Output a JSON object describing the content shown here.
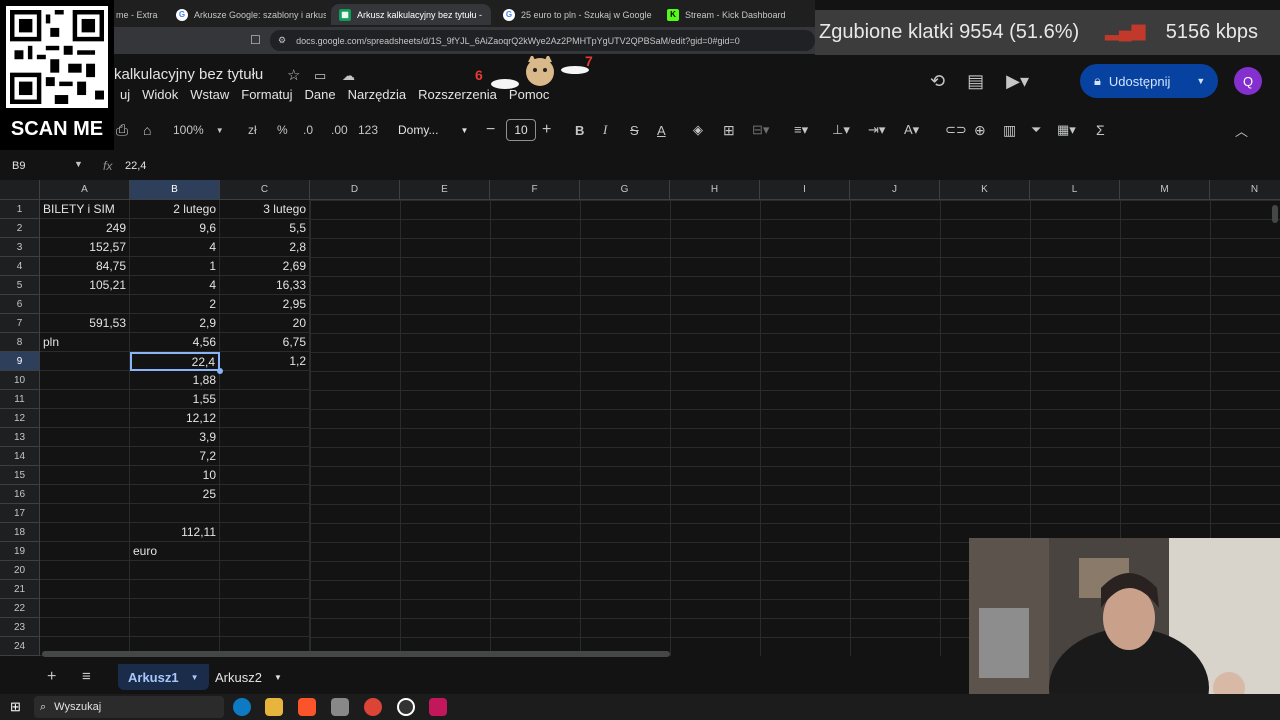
{
  "browser": {
    "tabs": [
      {
        "label": "me - Extra",
        "active": false
      },
      {
        "label": "Arkusze Google: szablony i arkusze k",
        "active": false
      },
      {
        "label": "Arkusz kalkulacyjny bez tytułu -",
        "active": true
      },
      {
        "label": "25 euro to pln - Szukaj w Google",
        "active": false
      },
      {
        "label": "Stream - Kick Dashboard",
        "active": false
      }
    ],
    "url": "docs.google.com/spreadsheets/d/1S_9fYJL_6AiZaoqrQ2kWye2Az2PMHTpYgUTV2QPBSaM/edit?gid=0#gid=0"
  },
  "overlay": {
    "dropped_frames": "Zgubione klatki 9554 (51.6%)",
    "bitrate": "5156 kbps",
    "qr_label": "SCAN ME"
  },
  "doc": {
    "title": "kalkulacyjny bez tytułu",
    "menu": [
      "uj",
      "Widok",
      "Wstaw",
      "Formatuj",
      "Dane",
      "Narzędzia",
      "Rozszerzenia",
      "Pomoc"
    ],
    "share_label": "Udostępnij",
    "avatar_letter": "Q"
  },
  "toolbar": {
    "zoom": "100%",
    "currency": "zł",
    "percent": "%",
    "dec_less": ".0",
    "dec_more": ".00",
    "format_123": "123",
    "font": "Domy...",
    "font_size": "10"
  },
  "formula": {
    "cell_ref": "B9",
    "fx": "fx",
    "value": "22,4"
  },
  "grid": {
    "columns": [
      "A",
      "B",
      "C",
      "D",
      "E",
      "F",
      "G",
      "H",
      "I",
      "J",
      "K",
      "L",
      "M",
      "N"
    ],
    "selected_column": "B",
    "selected_row": 9,
    "rows": [
      {
        "n": "1",
        "A": "BILETY i SIM",
        "B": "2 lutego",
        "C": "3 lutego"
      },
      {
        "n": "2",
        "A": "249",
        "B": "9,6",
        "C": "5,5"
      },
      {
        "n": "3",
        "A": "152,57",
        "B": "4",
        "C": "2,8"
      },
      {
        "n": "4",
        "A": "84,75",
        "B": "1",
        "C": "2,69"
      },
      {
        "n": "5",
        "A": "105,21",
        "B": "4",
        "C": "16,33"
      },
      {
        "n": "6",
        "A": "",
        "B": "2",
        "C": "2,95"
      },
      {
        "n": "7",
        "A": "591,53",
        "B": "2,9",
        "C": "20"
      },
      {
        "n": "8",
        "A": "pln",
        "B": "4,56",
        "C": "6,75"
      },
      {
        "n": "9",
        "A": "",
        "B": "22,4",
        "C": "1,2"
      },
      {
        "n": "10",
        "A": "",
        "B": "1,88",
        "C": ""
      },
      {
        "n": "11",
        "A": "",
        "B": "1,55",
        "C": ""
      },
      {
        "n": "12",
        "A": "",
        "B": "12,12",
        "C": ""
      },
      {
        "n": "13",
        "A": "",
        "B": "3,9",
        "C": ""
      },
      {
        "n": "14",
        "A": "",
        "B": "7,2",
        "C": ""
      },
      {
        "n": "15",
        "A": "",
        "B": "10",
        "C": ""
      },
      {
        "n": "16",
        "A": "",
        "B": "25",
        "C": ""
      },
      {
        "n": "17",
        "A": "",
        "B": "",
        "C": ""
      },
      {
        "n": "18",
        "A": "",
        "B": "112,11",
        "C": ""
      },
      {
        "n": "19",
        "A": "",
        "B": "euro",
        "C": ""
      },
      {
        "n": "20",
        "A": "",
        "B": "",
        "C": ""
      },
      {
        "n": "21",
        "A": "",
        "B": "",
        "C": ""
      },
      {
        "n": "22",
        "A": "",
        "B": "",
        "C": ""
      },
      {
        "n": "23",
        "A": "",
        "B": "",
        "C": ""
      },
      {
        "n": "24",
        "A": "",
        "B": "",
        "C": ""
      }
    ]
  },
  "sheets": [
    {
      "label": "Arkusz1",
      "active": true
    },
    {
      "label": "Arkusz2",
      "active": false
    }
  ],
  "taskbar": {
    "search_label": "Wyszukaj"
  },
  "colors": {
    "accent": "#8ab4f8",
    "share_bg": "#0842a0",
    "avatar": "#8430ce"
  }
}
